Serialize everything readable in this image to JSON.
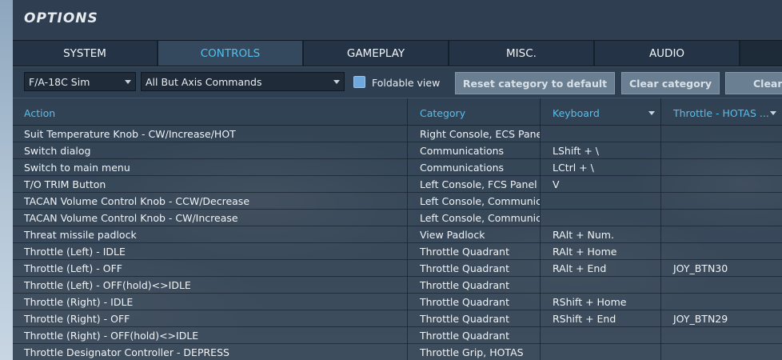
{
  "window": {
    "title": "OPTIONS"
  },
  "tabs": [
    {
      "label": "SYSTEM"
    },
    {
      "label": "CONTROLS",
      "active": true
    },
    {
      "label": "GAMEPLAY"
    },
    {
      "label": "MISC."
    },
    {
      "label": "AUDIO"
    }
  ],
  "toolbar": {
    "aircraft_select": "F/A-18C Sim",
    "filter_select": "All But Axis Commands",
    "foldable_view_label": "Foldable view",
    "foldable_view_checked": true,
    "reset_category_label": "Reset category to default",
    "clear_category_label": "Clear category",
    "clear_label": "Clear"
  },
  "table": {
    "headers": {
      "action": "Action",
      "category": "Category",
      "keyboard": "Keyboard",
      "throttle": "Throttle - HOTAS ..."
    },
    "rows": [
      {
        "action": "Suit Temperature Knob - CW/Increase/HOT",
        "category": "Right Console, ECS Panel",
        "keyboard": "",
        "throttle": ""
      },
      {
        "action": "Switch dialog",
        "category": "Communications",
        "keyboard": "LShift + \\",
        "throttle": ""
      },
      {
        "action": "Switch to main menu",
        "category": "Communications",
        "keyboard": "LCtrl + \\",
        "throttle": ""
      },
      {
        "action": "T/O TRIM Button",
        "category": "Left Console, FCS Panel",
        "keyboard": "V",
        "throttle": ""
      },
      {
        "action": "TACAN Volume Control Knob - CCW/Decrease",
        "category": "Left Console, Communicat",
        "keyboard": "",
        "throttle": ""
      },
      {
        "action": "TACAN Volume Control Knob - CW/Increase",
        "category": "Left Console, Communicat",
        "keyboard": "",
        "throttle": ""
      },
      {
        "action": "Threat missile padlock",
        "category": "View Padlock",
        "keyboard": "RAlt + Num.",
        "throttle": ""
      },
      {
        "action": "Throttle (Left) - IDLE",
        "category": "Throttle Quadrant",
        "keyboard": "RAlt + Home",
        "throttle": ""
      },
      {
        "action": "Throttle (Left) - OFF",
        "category": "Throttle Quadrant",
        "keyboard": "RAlt + End",
        "throttle": "JOY_BTN30"
      },
      {
        "action": "Throttle (Left) - OFF(hold)<>IDLE",
        "category": "Throttle Quadrant",
        "keyboard": "",
        "throttle": ""
      },
      {
        "action": "Throttle (Right) - IDLE",
        "category": "Throttle Quadrant",
        "keyboard": "RShift + Home",
        "throttle": ""
      },
      {
        "action": "Throttle (Right) - OFF",
        "category": "Throttle Quadrant",
        "keyboard": "RShift + End",
        "throttle": "JOY_BTN29"
      },
      {
        "action": "Throttle (Right) - OFF(hold)<>IDLE",
        "category": "Throttle Quadrant",
        "keyboard": "",
        "throttle": ""
      },
      {
        "action": "Throttle Designator Controller - DEPRESS",
        "category": "Throttle Grip, HOTAS",
        "keyboard": "",
        "throttle": ""
      }
    ]
  }
}
